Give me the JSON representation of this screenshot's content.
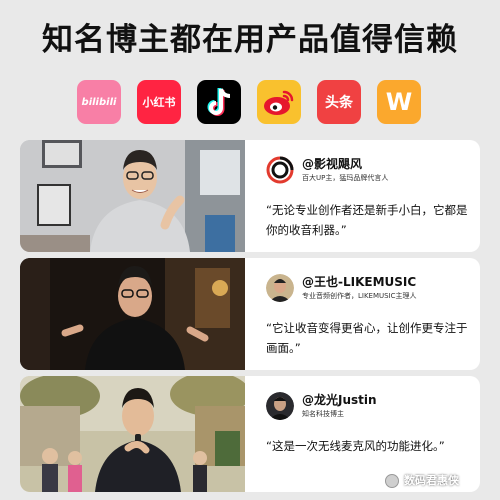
{
  "headline": "知名博主都在用产品值得信赖",
  "apps": [
    {
      "name": "bilibili",
      "label": "bilibili",
      "bg": "#f87fa6",
      "fg": "#ffffff",
      "icon": "bilibili-icon"
    },
    {
      "name": "xiaohongshu",
      "label": "小红书",
      "bg": "#ff2442",
      "fg": "#ffffff",
      "icon": "xiaohongshu-icon"
    },
    {
      "name": "tiktok",
      "label": "",
      "bg": "#000000",
      "fg": "#ffffff",
      "icon": "tiktok-icon"
    },
    {
      "name": "weibo",
      "label": "",
      "bg": "#f9c12e",
      "fg": "#e6162d",
      "icon": "weibo-icon"
    },
    {
      "name": "toutiao",
      "label": "头条",
      "bg": "#f04142",
      "fg": "#ffffff",
      "icon": "toutiao-icon"
    },
    {
      "name": "app-w",
      "label": "W",
      "bg": "#fba82d",
      "fg": "#ffffff",
      "icon": "w-icon"
    }
  ],
  "cards": [
    {
      "handle": "@影视飓风",
      "role": "百大UP主，猛玛品牌代言人",
      "quote": "“无论专业创作者还是新手小白，它都是你的收音利器。”"
    },
    {
      "handle": "@王也-LIKEMUSIC",
      "role": "专业音频创作者，LIKEMUSIC主理人",
      "quote": "“它让收音变得更省心，让创作更专注于画面。”"
    },
    {
      "handle": "@龙光Justin",
      "role": "知名科技博主",
      "quote": "“这是一次无线麦克风的功能进化。”"
    }
  ],
  "watermark": "数码君惠侠"
}
